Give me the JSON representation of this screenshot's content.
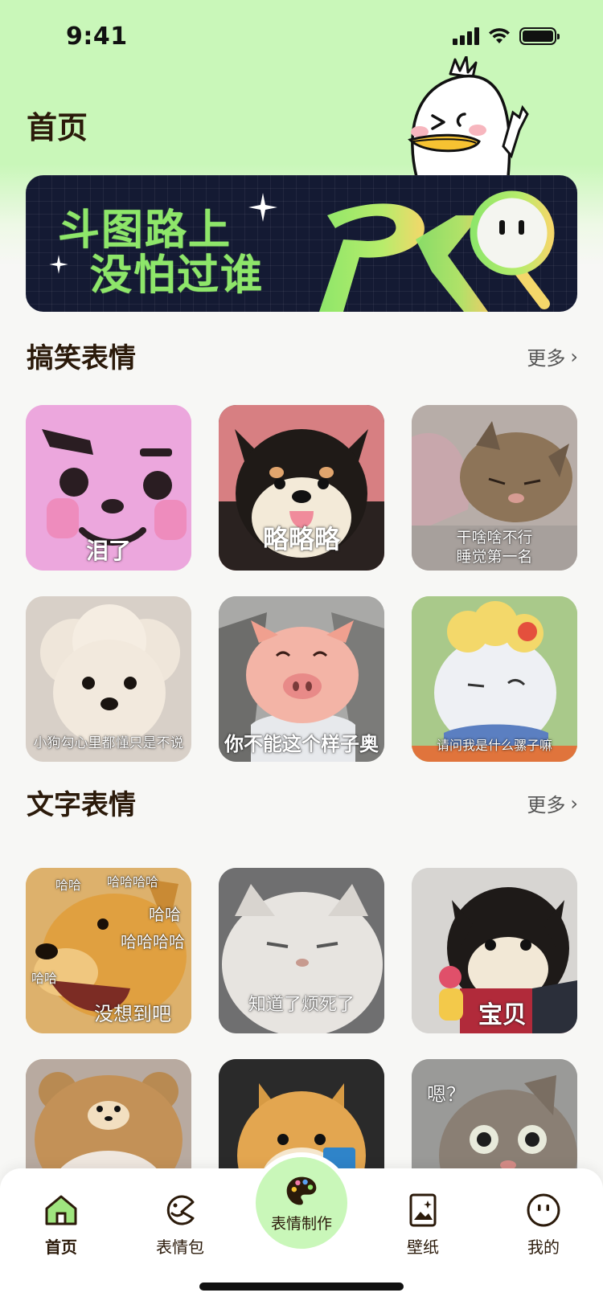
{
  "status_bar": {
    "time": "9:41"
  },
  "header": {
    "title": "首页"
  },
  "banner": {
    "line1": "斗图路上",
    "line2": "没怕过谁",
    "pro_text": "PRO"
  },
  "sections": [
    {
      "title": "搞笑表情",
      "more_label": "更多",
      "items": [
        {
          "caption": "泪了"
        },
        {
          "caption": "略略略"
        },
        {
          "caption": "干啥啥不行",
          "caption2": "睡觉第一名"
        },
        {
          "caption": "小狗勾心里都懂只是不说"
        },
        {
          "caption": "你不能这个样子奥"
        },
        {
          "caption": "请问我是什么骡子嘛"
        }
      ]
    },
    {
      "title": "文字表情",
      "more_label": "更多",
      "items": [
        {
          "caption": "没想到吧",
          "extra": [
            "哈哈",
            "哈哈哈哈",
            "哈哈",
            "哈哈哈哈",
            "哈哈"
          ]
        },
        {
          "caption": "知道了烦死了"
        },
        {
          "caption": "宝贝"
        },
        {
          "caption": ""
        },
        {
          "caption": ""
        },
        {
          "caption": "嗯？"
        }
      ]
    }
  ],
  "tabbar": {
    "items": [
      {
        "label": "首页",
        "icon": "home-icon"
      },
      {
        "label": "表情包",
        "icon": "sticker-face-icon"
      },
      {
        "label": "表情制作",
        "icon": "palette-icon"
      },
      {
        "label": "壁纸",
        "icon": "wallpaper-icon"
      },
      {
        "label": "我的",
        "icon": "smiley-icon"
      }
    ]
  },
  "colors": {
    "accent_green": "#c9f7b9",
    "banner_bg": "#141a33",
    "banner_text": "#8ee66a"
  }
}
